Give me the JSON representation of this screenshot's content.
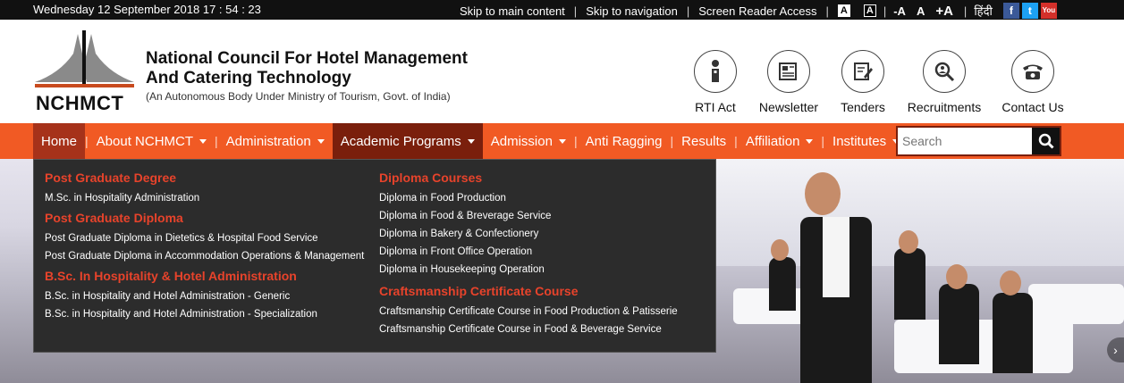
{
  "topbar": {
    "datetime": "Wednesday 12 September 2018 17 : 54 : 23",
    "skip_main": "Skip to main content",
    "skip_nav": "Skip to navigation",
    "screen_reader": "Screen Reader Access",
    "contrast_light": "A",
    "contrast_dark": "A",
    "font_decrease": "-A",
    "font_normal": "A",
    "font_increase": "+A",
    "hindi": "हिंदी",
    "social": [
      "facebook-icon",
      "twitter-icon",
      "youtube-icon"
    ]
  },
  "header": {
    "logo_text": "NCHMCT",
    "title": "National Council For Hotel Management And Catering Technology",
    "subtitle": "(An Autonomous Body Under Ministry of Tourism, Govt. of India)",
    "links": [
      {
        "label": "RTI Act",
        "icon": "rti-icon"
      },
      {
        "label": "Newsletter",
        "icon": "newsletter-icon"
      },
      {
        "label": "Tenders",
        "icon": "tenders-icon"
      },
      {
        "label": "Recruitments",
        "icon": "recruitments-icon"
      },
      {
        "label": "Contact Us",
        "icon": "phone-icon"
      }
    ]
  },
  "nav": {
    "items": [
      {
        "label": "Home"
      },
      {
        "label": "About NCHMCT"
      },
      {
        "label": "Administration"
      },
      {
        "label": "Academic Programs"
      },
      {
        "label": "Admission"
      },
      {
        "label": "Anti Ragging"
      },
      {
        "label": "Results"
      },
      {
        "label": "Affiliation"
      },
      {
        "label": "Institutes"
      }
    ],
    "search_placeholder": "Search"
  },
  "dropdown": {
    "col1": {
      "pg_degree": "Post Graduate Degree",
      "pg_degree_items": [
        "M.Sc. in Hospitality Administration"
      ],
      "pg_diploma": "Post Graduate Diploma",
      "pg_diploma_items": [
        "Post Graduate Diploma in Dietetics & Hospital Food Service",
        "Post Graduate Diploma in Accommodation Operations & Management"
      ],
      "bsc": "B.Sc. In Hospitality & Hotel Administration",
      "bsc_items": [
        "B.Sc. in Hospitality and Hotel Administration - Generic",
        "B.Sc. in Hospitality and Hotel Administration - Specialization"
      ]
    },
    "col2": {
      "diploma": "Diploma Courses",
      "diploma_items": [
        "Diploma in Food Production",
        "Diploma in Food & Breverage Service",
        "Diploma in Bakery & Confectionery",
        "Diploma in Front Office Operation",
        "Diploma in Housekeeping Operation"
      ],
      "craft": "Craftsmanship Certificate Course",
      "craft_items": [
        "Craftsmanship Certificate Course in Food Production & Patisserie",
        "Craftsmanship Certificate Course in Food & Beverage Service"
      ]
    }
  },
  "colors": {
    "topbar_bg": "#111111",
    "nav_bg": "#f15a24",
    "nav_active": "#7a1f0c",
    "dropdown_bg": "#2c2c2c",
    "dropdown_heading": "#e8432b"
  }
}
